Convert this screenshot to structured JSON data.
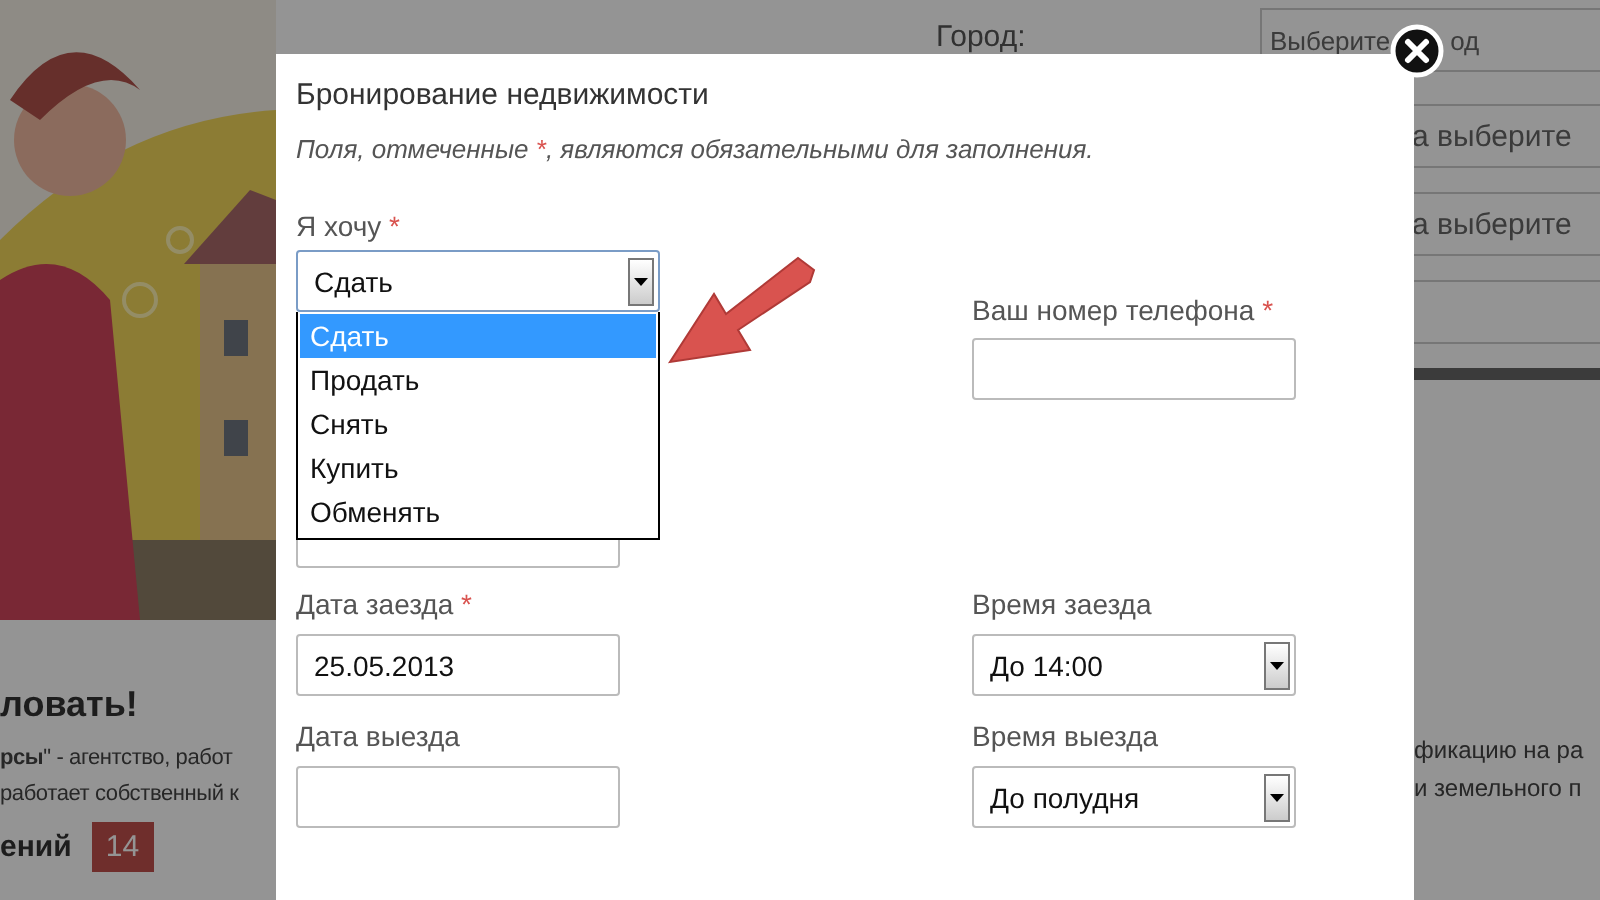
{
  "background": {
    "left_texts": [
      {
        "kind": "heading",
        "text": "ловать!"
      },
      {
        "kind": "paragraph",
        "text": "**рсы**\" - агентство, работ"
      },
      {
        "kind": "paragraph",
        "text": "работает собственный к"
      }
    ],
    "counter": {
      "label": "ений",
      "count": "14"
    },
    "city": {
      "label": "Город:",
      "placeholder_start": "Выберите",
      "placeholder_end": "од"
    },
    "fields": [
      {
        "text": "а выберите"
      },
      {
        "text": "а выберите"
      }
    ],
    "right_texts": [
      "фикацию на ра",
      "и земельного п"
    ]
  },
  "modal": {
    "title": "Бронирование недвижимости",
    "note": {
      "before": "Поля, отмеченные ",
      "mark": "*",
      "after": ", являются обязательными для заполнения."
    },
    "required_mark": "*",
    "want": {
      "label": "Я хочу",
      "required": true,
      "value": "Сдать",
      "expanded": true,
      "options": [
        {
          "label": "Сдать",
          "selected": true
        },
        {
          "label": "Продать",
          "selected": false
        },
        {
          "label": "Снять",
          "selected": false
        },
        {
          "label": "Купить",
          "selected": false
        },
        {
          "label": "Обменять",
          "selected": false
        }
      ]
    },
    "phone": {
      "label": "Ваш номер телефона",
      "required": true
    },
    "dates": [
      {
        "label": "Дата заезда",
        "required": true,
        "value": "25.05.2013"
      },
      {
        "label": "Дата выезда",
        "required": false
      }
    ],
    "times": [
      {
        "label": "Время заезда",
        "value": "До 14:00"
      },
      {
        "label": "Время выезда",
        "value": "До полудня"
      }
    ]
  }
}
